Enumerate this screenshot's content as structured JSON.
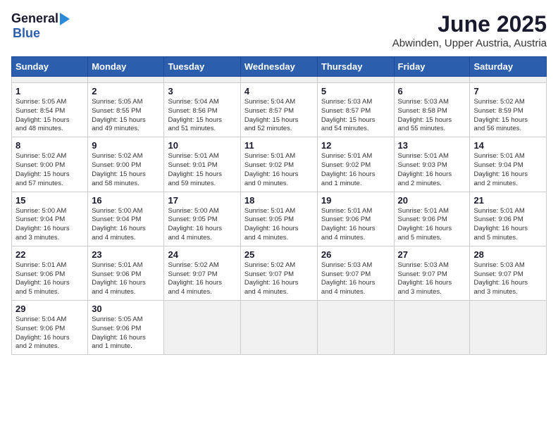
{
  "header": {
    "logo_general": "General",
    "logo_blue": "Blue",
    "month": "June 2025",
    "location": "Abwinden, Upper Austria, Austria"
  },
  "calendar": {
    "days_of_week": [
      "Sunday",
      "Monday",
      "Tuesday",
      "Wednesday",
      "Thursday",
      "Friday",
      "Saturday"
    ],
    "weeks": [
      [
        {
          "day": "",
          "info": ""
        },
        {
          "day": "",
          "info": ""
        },
        {
          "day": "",
          "info": ""
        },
        {
          "day": "",
          "info": ""
        },
        {
          "day": "",
          "info": ""
        },
        {
          "day": "",
          "info": ""
        },
        {
          "day": "",
          "info": ""
        }
      ],
      [
        {
          "day": "1",
          "info": "Sunrise: 5:05 AM\nSunset: 8:54 PM\nDaylight: 15 hours\nand 48 minutes."
        },
        {
          "day": "2",
          "info": "Sunrise: 5:05 AM\nSunset: 8:55 PM\nDaylight: 15 hours\nand 49 minutes."
        },
        {
          "day": "3",
          "info": "Sunrise: 5:04 AM\nSunset: 8:56 PM\nDaylight: 15 hours\nand 51 minutes."
        },
        {
          "day": "4",
          "info": "Sunrise: 5:04 AM\nSunset: 8:57 PM\nDaylight: 15 hours\nand 52 minutes."
        },
        {
          "day": "5",
          "info": "Sunrise: 5:03 AM\nSunset: 8:57 PM\nDaylight: 15 hours\nand 54 minutes."
        },
        {
          "day": "6",
          "info": "Sunrise: 5:03 AM\nSunset: 8:58 PM\nDaylight: 15 hours\nand 55 minutes."
        },
        {
          "day": "7",
          "info": "Sunrise: 5:02 AM\nSunset: 8:59 PM\nDaylight: 15 hours\nand 56 minutes."
        }
      ],
      [
        {
          "day": "8",
          "info": "Sunrise: 5:02 AM\nSunset: 9:00 PM\nDaylight: 15 hours\nand 57 minutes."
        },
        {
          "day": "9",
          "info": "Sunrise: 5:02 AM\nSunset: 9:00 PM\nDaylight: 15 hours\nand 58 minutes."
        },
        {
          "day": "10",
          "info": "Sunrise: 5:01 AM\nSunset: 9:01 PM\nDaylight: 15 hours\nand 59 minutes."
        },
        {
          "day": "11",
          "info": "Sunrise: 5:01 AM\nSunset: 9:02 PM\nDaylight: 16 hours\nand 0 minutes."
        },
        {
          "day": "12",
          "info": "Sunrise: 5:01 AM\nSunset: 9:02 PM\nDaylight: 16 hours\nand 1 minute."
        },
        {
          "day": "13",
          "info": "Sunrise: 5:01 AM\nSunset: 9:03 PM\nDaylight: 16 hours\nand 2 minutes."
        },
        {
          "day": "14",
          "info": "Sunrise: 5:01 AM\nSunset: 9:04 PM\nDaylight: 16 hours\nand 2 minutes."
        }
      ],
      [
        {
          "day": "15",
          "info": "Sunrise: 5:00 AM\nSunset: 9:04 PM\nDaylight: 16 hours\nand 3 minutes."
        },
        {
          "day": "16",
          "info": "Sunrise: 5:00 AM\nSunset: 9:04 PM\nDaylight: 16 hours\nand 4 minutes."
        },
        {
          "day": "17",
          "info": "Sunrise: 5:00 AM\nSunset: 9:05 PM\nDaylight: 16 hours\nand 4 minutes."
        },
        {
          "day": "18",
          "info": "Sunrise: 5:01 AM\nSunset: 9:05 PM\nDaylight: 16 hours\nand 4 minutes."
        },
        {
          "day": "19",
          "info": "Sunrise: 5:01 AM\nSunset: 9:06 PM\nDaylight: 16 hours\nand 4 minutes."
        },
        {
          "day": "20",
          "info": "Sunrise: 5:01 AM\nSunset: 9:06 PM\nDaylight: 16 hours\nand 5 minutes."
        },
        {
          "day": "21",
          "info": "Sunrise: 5:01 AM\nSunset: 9:06 PM\nDaylight: 16 hours\nand 5 minutes."
        }
      ],
      [
        {
          "day": "22",
          "info": "Sunrise: 5:01 AM\nSunset: 9:06 PM\nDaylight: 16 hours\nand 5 minutes."
        },
        {
          "day": "23",
          "info": "Sunrise: 5:01 AM\nSunset: 9:06 PM\nDaylight: 16 hours\nand 4 minutes."
        },
        {
          "day": "24",
          "info": "Sunrise: 5:02 AM\nSunset: 9:07 PM\nDaylight: 16 hours\nand 4 minutes."
        },
        {
          "day": "25",
          "info": "Sunrise: 5:02 AM\nSunset: 9:07 PM\nDaylight: 16 hours\nand 4 minutes."
        },
        {
          "day": "26",
          "info": "Sunrise: 5:03 AM\nSunset: 9:07 PM\nDaylight: 16 hours\nand 4 minutes."
        },
        {
          "day": "27",
          "info": "Sunrise: 5:03 AM\nSunset: 9:07 PM\nDaylight: 16 hours\nand 3 minutes."
        },
        {
          "day": "28",
          "info": "Sunrise: 5:03 AM\nSunset: 9:07 PM\nDaylight: 16 hours\nand 3 minutes."
        }
      ],
      [
        {
          "day": "29",
          "info": "Sunrise: 5:04 AM\nSunset: 9:06 PM\nDaylight: 16 hours\nand 2 minutes."
        },
        {
          "day": "30",
          "info": "Sunrise: 5:05 AM\nSunset: 9:06 PM\nDaylight: 16 hours\nand 1 minute."
        },
        {
          "day": "",
          "info": ""
        },
        {
          "day": "",
          "info": ""
        },
        {
          "day": "",
          "info": ""
        },
        {
          "day": "",
          "info": ""
        },
        {
          "day": "",
          "info": ""
        }
      ]
    ]
  }
}
